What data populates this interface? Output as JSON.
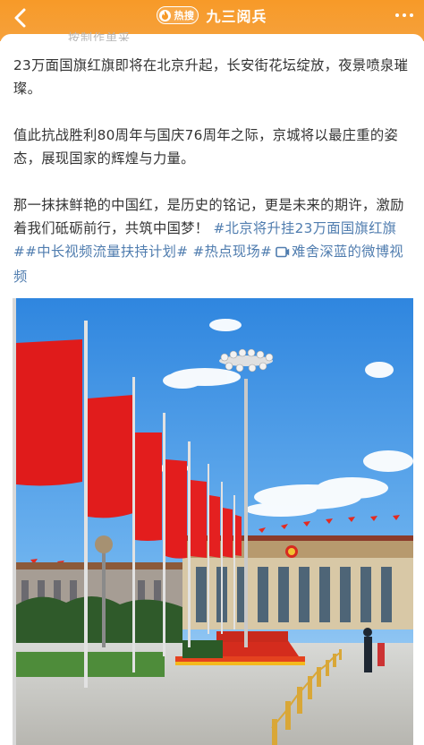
{
  "header": {
    "back_icon": "chevron-left-icon",
    "hot_badge_label": "热搜",
    "title": "九三阅兵",
    "more_icon": "more-dots-icon",
    "background_color": "#f79a28"
  },
  "post": {
    "cut_off_text": "按制作单采",
    "paragraphs": [
      "23万面国旗红旗即将在北京升起，长安街花坛绽放，夜景喷泉璀璨。",
      "值此抗战胜利80周年与国庆76周年之际，京城将以最庄重的姿态，展现国家的辉煌与力量。",
      "那一抹抹鲜艳的中国红，是历史的铭记，更是未来的期许，激励着我们砥砺前行，共筑中国梦！"
    ],
    "topics": [
      "#北京将升挂23万面国旗红旗#",
      "#中长视频流量扶持计划#",
      "#热点现场#"
    ],
    "video_link": "难舍深蓝的微博视频",
    "link_color": "#507daf"
  },
  "media": {
    "type": "photo",
    "subject": "flags-great-hall"
  }
}
